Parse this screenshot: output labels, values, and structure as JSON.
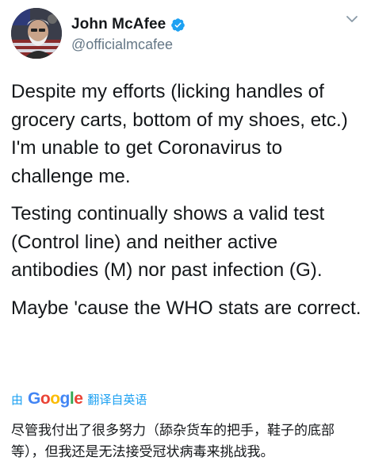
{
  "author": {
    "display_name": "John McAfee",
    "handle": "@officialmcafee",
    "verified": true,
    "avatar": "portrait-avatar"
  },
  "icons": {
    "verified": "verified-badge-icon",
    "menu": "chevron-down-icon"
  },
  "tweet": {
    "paragraphs": [
      "Despite my efforts (licking handles of grocery carts, bottom of my shoes, etc.) I'm unable to get Coronavirus to challenge me.",
      "Testing continually shows a valid test (Control line) and neither active antibodies (M) nor past infection (G).",
      "Maybe 'cause the WHO stats are correct."
    ]
  },
  "translation": {
    "by_label": "由",
    "provider": "Google",
    "from_label": "翻译自英语",
    "text": "尽管我付出了很多努力（舔杂货车的把手，鞋子的底部等），但我还是无法接受冠状病毒来挑战我。"
  },
  "colors": {
    "text": "#14171a",
    "secondary": "#657786",
    "accent": "#1da1f2",
    "google_blue": "#4285f4",
    "google_red": "#ea4335",
    "google_yellow": "#fbbc05",
    "google_green": "#34a853"
  }
}
